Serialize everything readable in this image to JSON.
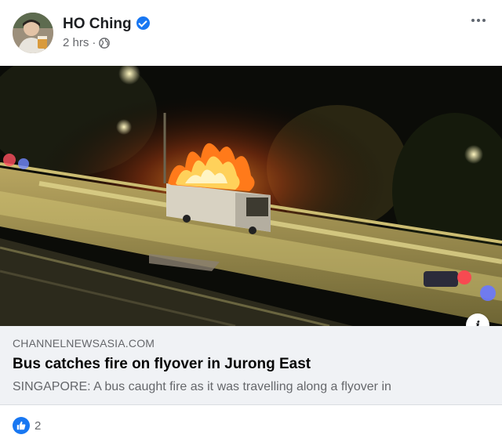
{
  "post": {
    "author": "HO Ching",
    "time": "2 hrs",
    "separator": "·",
    "audience_icon": "globe-icon",
    "verified_icon": "verified-badge-icon",
    "more_icon": "more-options-icon"
  },
  "link_preview": {
    "domain": "CHANNELNEWSASIA.COM",
    "title": "Bus catches fire on flyover in Jurong East",
    "description": "SINGAPORE: A bus caught fire as it was travelling along a flyover in",
    "info_icon": "i"
  },
  "reactions": {
    "icon": "like-icon",
    "count": "2"
  },
  "colors": {
    "accent": "#1877f2",
    "preview_bg": "#f0f2f5",
    "secondary_text": "#65676b"
  }
}
